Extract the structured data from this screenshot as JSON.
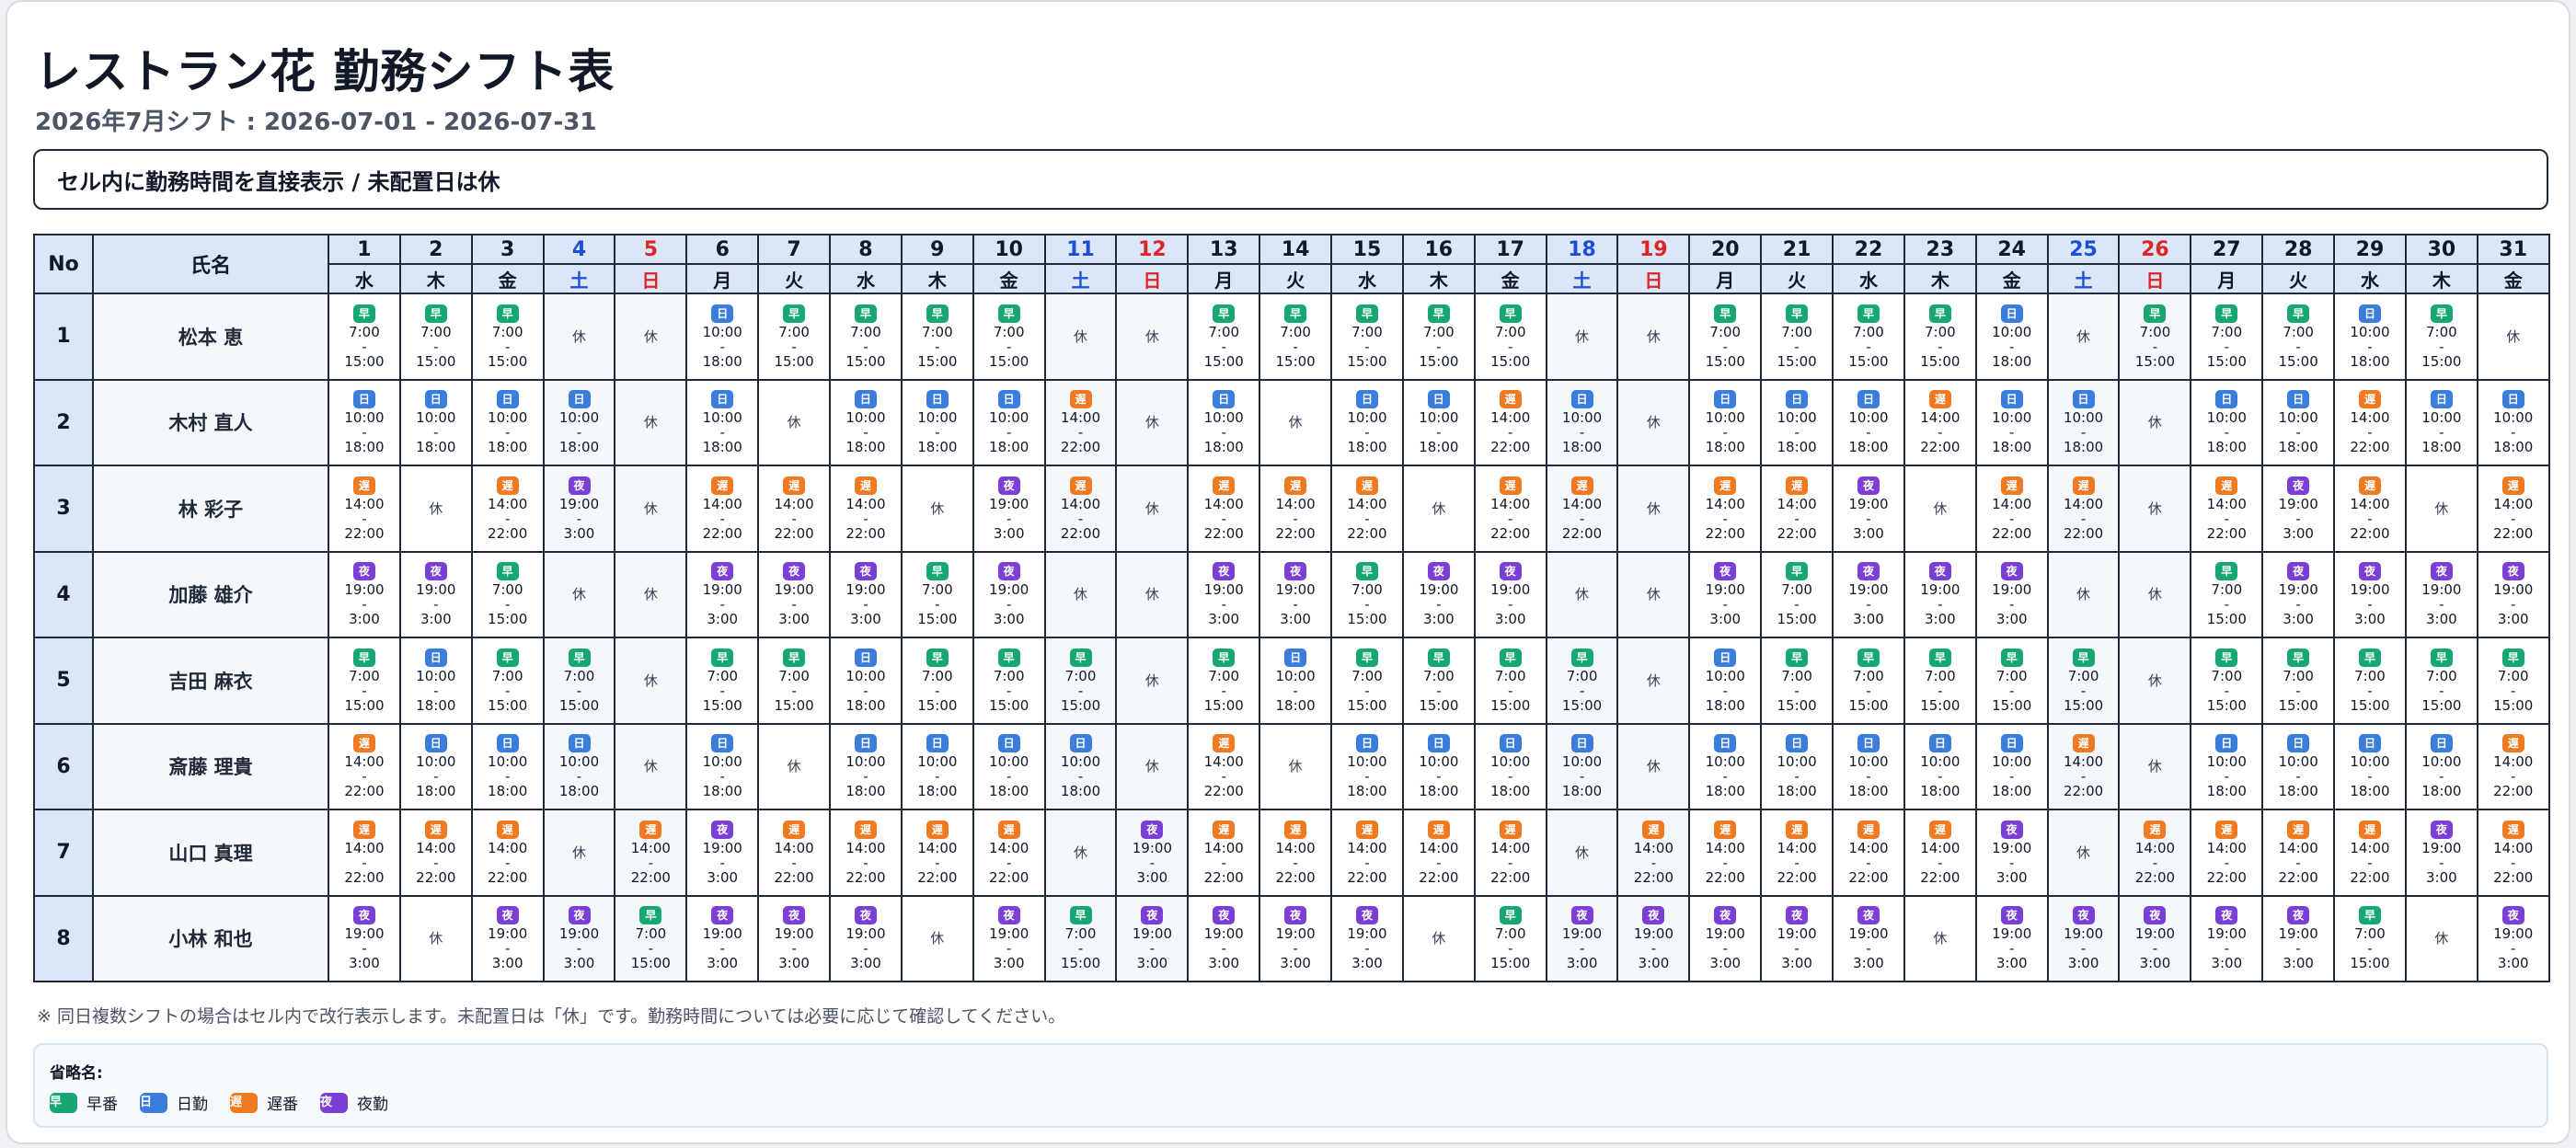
{
  "title": "レストラン花 勤務シフト表",
  "subtitle": "2026年7月シフト : 2026-07-01 - 2026-07-31",
  "notice": "セル内に勤務時間を直接表示 / 未配置日は休",
  "table": {
    "no_header": "No",
    "name_header": "氏名",
    "off_label": "休",
    "dash": "-",
    "days": [
      {
        "d": "1",
        "w": "水"
      },
      {
        "d": "2",
        "w": "木"
      },
      {
        "d": "3",
        "w": "金"
      },
      {
        "d": "4",
        "w": "土"
      },
      {
        "d": "5",
        "w": "日"
      },
      {
        "d": "6",
        "w": "月"
      },
      {
        "d": "7",
        "w": "火"
      },
      {
        "d": "8",
        "w": "水"
      },
      {
        "d": "9",
        "w": "木"
      },
      {
        "d": "10",
        "w": "金"
      },
      {
        "d": "11",
        "w": "土"
      },
      {
        "d": "12",
        "w": "日"
      },
      {
        "d": "13",
        "w": "月"
      },
      {
        "d": "14",
        "w": "火"
      },
      {
        "d": "15",
        "w": "水"
      },
      {
        "d": "16",
        "w": "木"
      },
      {
        "d": "17",
        "w": "金"
      },
      {
        "d": "18",
        "w": "土"
      },
      {
        "d": "19",
        "w": "日"
      },
      {
        "d": "20",
        "w": "月"
      },
      {
        "d": "21",
        "w": "火"
      },
      {
        "d": "22",
        "w": "水"
      },
      {
        "d": "23",
        "w": "木"
      },
      {
        "d": "24",
        "w": "金"
      },
      {
        "d": "25",
        "w": "土"
      },
      {
        "d": "26",
        "w": "日"
      },
      {
        "d": "27",
        "w": "月"
      },
      {
        "d": "28",
        "w": "火"
      },
      {
        "d": "29",
        "w": "水"
      },
      {
        "d": "30",
        "w": "木"
      },
      {
        "d": "31",
        "w": "金"
      }
    ],
    "employees": [
      {
        "no": "1",
        "name": "松本 恵",
        "shifts": "EEE--DEEEE--EEEEE--EEEED-EEEDE"
      },
      {
        "no": "2",
        "name": "木村 直人",
        "shifts": "DDDD-D-DDDL-D-DDLD-DDDLDD-DDLDD"
      },
      {
        "no": "3",
        "name": "林 彩子",
        "shifts": "L-LN-LLL-NL-LLL-LL-LLN-LL-LNL-L"
      },
      {
        "no": "4",
        "name": "加藤 雄介",
        "shifts": "NNE--NNNEN--NNENN--NENNN--ENNNN"
      },
      {
        "no": "5",
        "name": "吉田 麻衣",
        "shifts": "EDEE-EEDEEE-EDEEEE-DEEEEE-EEEEE"
      },
      {
        "no": "6",
        "name": "斎藤 理貴",
        "shifts": "LDDD-D-DDDD-L-DDDD-DDDDDL-DDDDL"
      },
      {
        "no": "7",
        "name": "山口 真理",
        "shifts": "LLL-LNLLLL-NLLLLL-LLLLLN-LLLLNL"
      },
      {
        "no": "8",
        "name": "小林 和也",
        "shifts": "N-NNENNN-NENNNN-ENNNNN-NNNNNE-N"
      }
    ]
  },
  "shift_types": {
    "E": {
      "abbr": "早",
      "start": "7:00",
      "end": "15:00",
      "color": "#16a772"
    },
    "D": {
      "abbr": "日",
      "start": "10:00",
      "end": "18:00",
      "color": "#3b7ddd"
    },
    "L": {
      "abbr": "遅",
      "start": "14:00",
      "end": "22:00",
      "color": "#ef7a22"
    },
    "N": {
      "abbr": "夜",
      "start": "19:00",
      "end": "3:00",
      "color": "#7c3fd6"
    }
  },
  "footnote": "※ 同日複数シフトの場合はセル内で改行表示します。未配置日は「休」です。勤務時間については必要に応じて確認してください。",
  "legend": {
    "title": "省略名:",
    "items": [
      {
        "abbr": "早",
        "label": "早番"
      },
      {
        "abbr": "日",
        "label": "日勤"
      },
      {
        "abbr": "遅",
        "label": "遅番"
      },
      {
        "abbr": "夜",
        "label": "夜勤"
      }
    ]
  }
}
